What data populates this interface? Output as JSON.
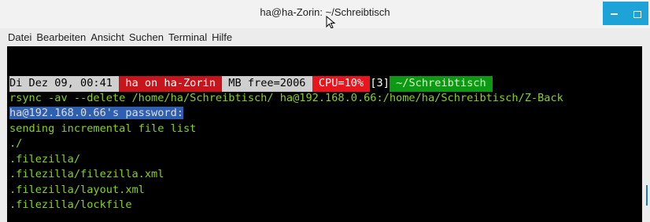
{
  "window": {
    "title": "ha@ha-Zorin: ~/Schreibtisch",
    "minimize": "minimize",
    "maximize": "maximize"
  },
  "menubar": {
    "items": [
      "Datei",
      "Bearbeiten",
      "Ansicht",
      "Suchen",
      "Terminal",
      "Hilfe"
    ]
  },
  "terminal": {
    "prompt": {
      "date": "Di Dez 09, 00:41 ",
      "host": " ha on ha-Zorin ",
      "mem": " MB free=2006 ",
      "cpu": " CPU=10% ",
      "jobs": "[3]",
      "dir": " ~/Schreibtisch "
    },
    "command": "rsync -av --delete /home/ha/Schreibtisch/ ha@192.168.0.66:/home/ha/Schreibtisch/Z-Back",
    "password_prompt": "ha@192.168.0.66's password:",
    "output": [
      "sending incremental file list",
      "./",
      ".filezilla/",
      ".filezilla/filezilla.xml",
      ".filezilla/layout.xml",
      ".filezilla/lockfile"
    ]
  },
  "colors": {
    "terminal_bg": "#000000",
    "green_text": "#86d31a",
    "accent_blue": "#1ea3d8",
    "selection_blue": "#2f5fb0"
  }
}
